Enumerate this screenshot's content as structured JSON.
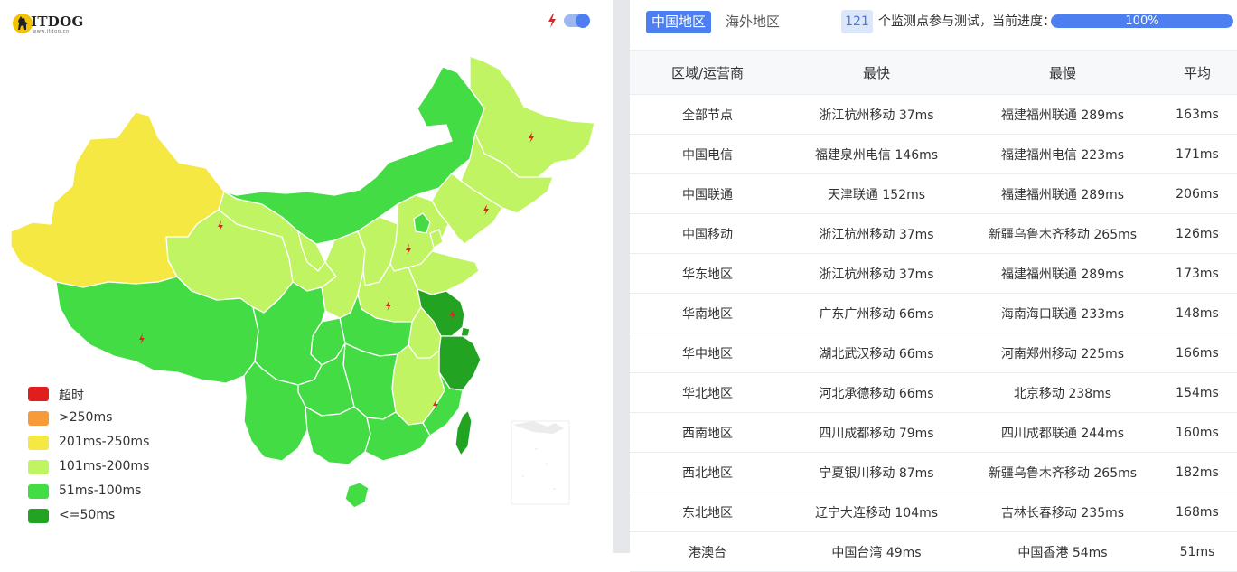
{
  "logo": {
    "text": "ITDOG",
    "url": "www.itdog.cn"
  },
  "map_controls": {
    "bolt_icon": "bolt-icon",
    "switch_on": true
  },
  "colors": {
    "timeout": "#e01e1e",
    "over250": "#f79a3a",
    "r201_250": "#f5e842",
    "r101_200": "#c0f462",
    "r51_100": "#44dc44",
    "r_le50": "#22a322",
    "accent": "#4e7ff0",
    "divider": "#e5e7eb"
  },
  "legend": [
    {
      "label": "超时",
      "color": "#e01e1e"
    },
    {
      "label": ">250ms",
      "color": "#f79a3a"
    },
    {
      "label": "201ms-250ms",
      "color": "#f5e842"
    },
    {
      "label": "101ms-200ms",
      "color": "#c0f462"
    },
    {
      "label": "51ms-100ms",
      "color": "#44dc44"
    },
    {
      "label": "<=50ms",
      "color": "#22a322"
    }
  ],
  "tabs": [
    {
      "label": "中国地区",
      "active": true
    },
    {
      "label": "海外地区",
      "active": false
    }
  ],
  "status": {
    "node_count": "121",
    "progress_label": "个监测点参与测试，当前进度：",
    "progress_text": "100%",
    "progress_value": 1.0
  },
  "table": {
    "headers": [
      "区域/运营商",
      "最快",
      "最慢",
      "平均"
    ],
    "rows": [
      [
        "全部节点",
        "浙江杭州移动 37ms",
        "福建福州联通 289ms",
        "163ms"
      ],
      [
        "中国电信",
        "福建泉州电信 146ms",
        "福建福州电信 223ms",
        "171ms"
      ],
      [
        "中国联通",
        "天津联通 152ms",
        "福建福州联通 289ms",
        "206ms"
      ],
      [
        "中国移动",
        "浙江杭州移动 37ms",
        "新疆乌鲁木齐移动 265ms",
        "126ms"
      ],
      [
        "华东地区",
        "浙江杭州移动 37ms",
        "福建福州联通 289ms",
        "173ms"
      ],
      [
        "华南地区",
        "广东广州移动 66ms",
        "海南海口联通 233ms",
        "148ms"
      ],
      [
        "华中地区",
        "湖北武汉移动 66ms",
        "河南郑州移动 225ms",
        "166ms"
      ],
      [
        "华北地区",
        "河北承德移动 66ms",
        "北京移动 238ms",
        "154ms"
      ],
      [
        "西南地区",
        "四川成都移动 79ms",
        "四川成都联通 244ms",
        "160ms"
      ],
      [
        "西北地区",
        "宁夏银川移动 87ms",
        "新疆乌鲁木齐移动 265ms",
        "182ms"
      ],
      [
        "东北地区",
        "辽宁大连移动 104ms",
        "吉林长春移动 235ms",
        "168ms"
      ],
      [
        "港澳台",
        "中国台湾 49ms",
        "中国香港 54ms",
        "51ms"
      ]
    ]
  }
}
